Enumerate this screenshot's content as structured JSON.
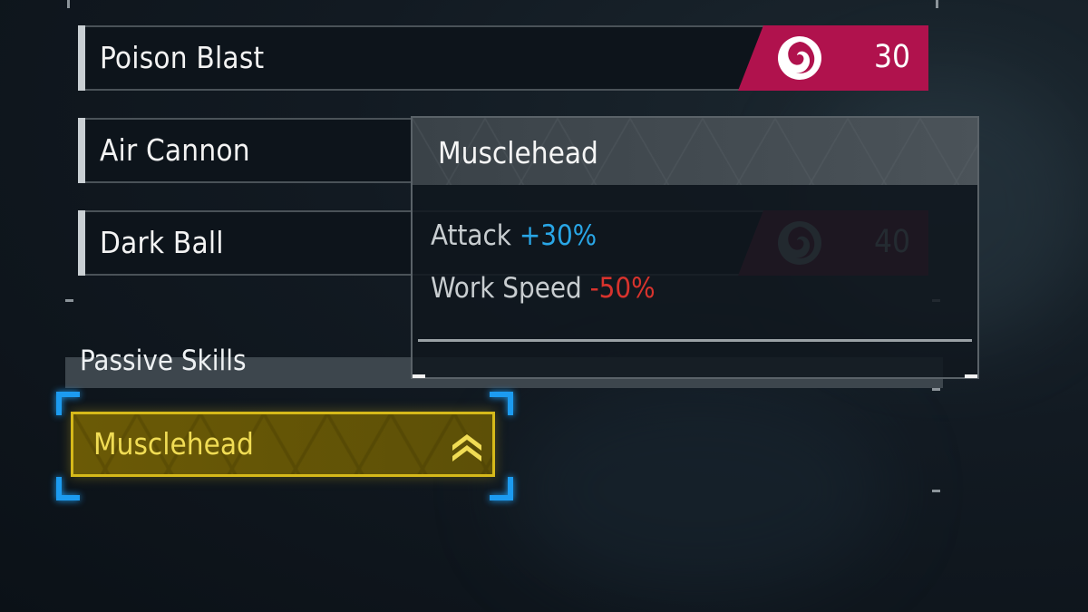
{
  "active_skills": [
    {
      "name": "Poison Blast",
      "element": "dark-element-icon",
      "power": "30"
    },
    {
      "name": "Air Cannon",
      "element": "",
      "power": ""
    },
    {
      "name": "Dark Ball",
      "element": "dark-element-icon",
      "power": "40"
    }
  ],
  "passive_section": {
    "title": "Passive Skills",
    "selected": {
      "name": "Musclehead",
      "rank_icon": "rank-up-chevrons-icon"
    }
  },
  "tooltip": {
    "title": "Musclehead",
    "effects": [
      {
        "label": "Attack",
        "value": "+30%",
        "kind": "positive"
      },
      {
        "label": "Work Speed",
        "value": "-50%",
        "kind": "negative"
      }
    ]
  },
  "colors": {
    "dark_element": "#b0124d",
    "positive": "#29a6e6",
    "negative": "#d8332d",
    "selection_frame": "#1c9bf0",
    "passive_gold": "#d6b91a"
  }
}
